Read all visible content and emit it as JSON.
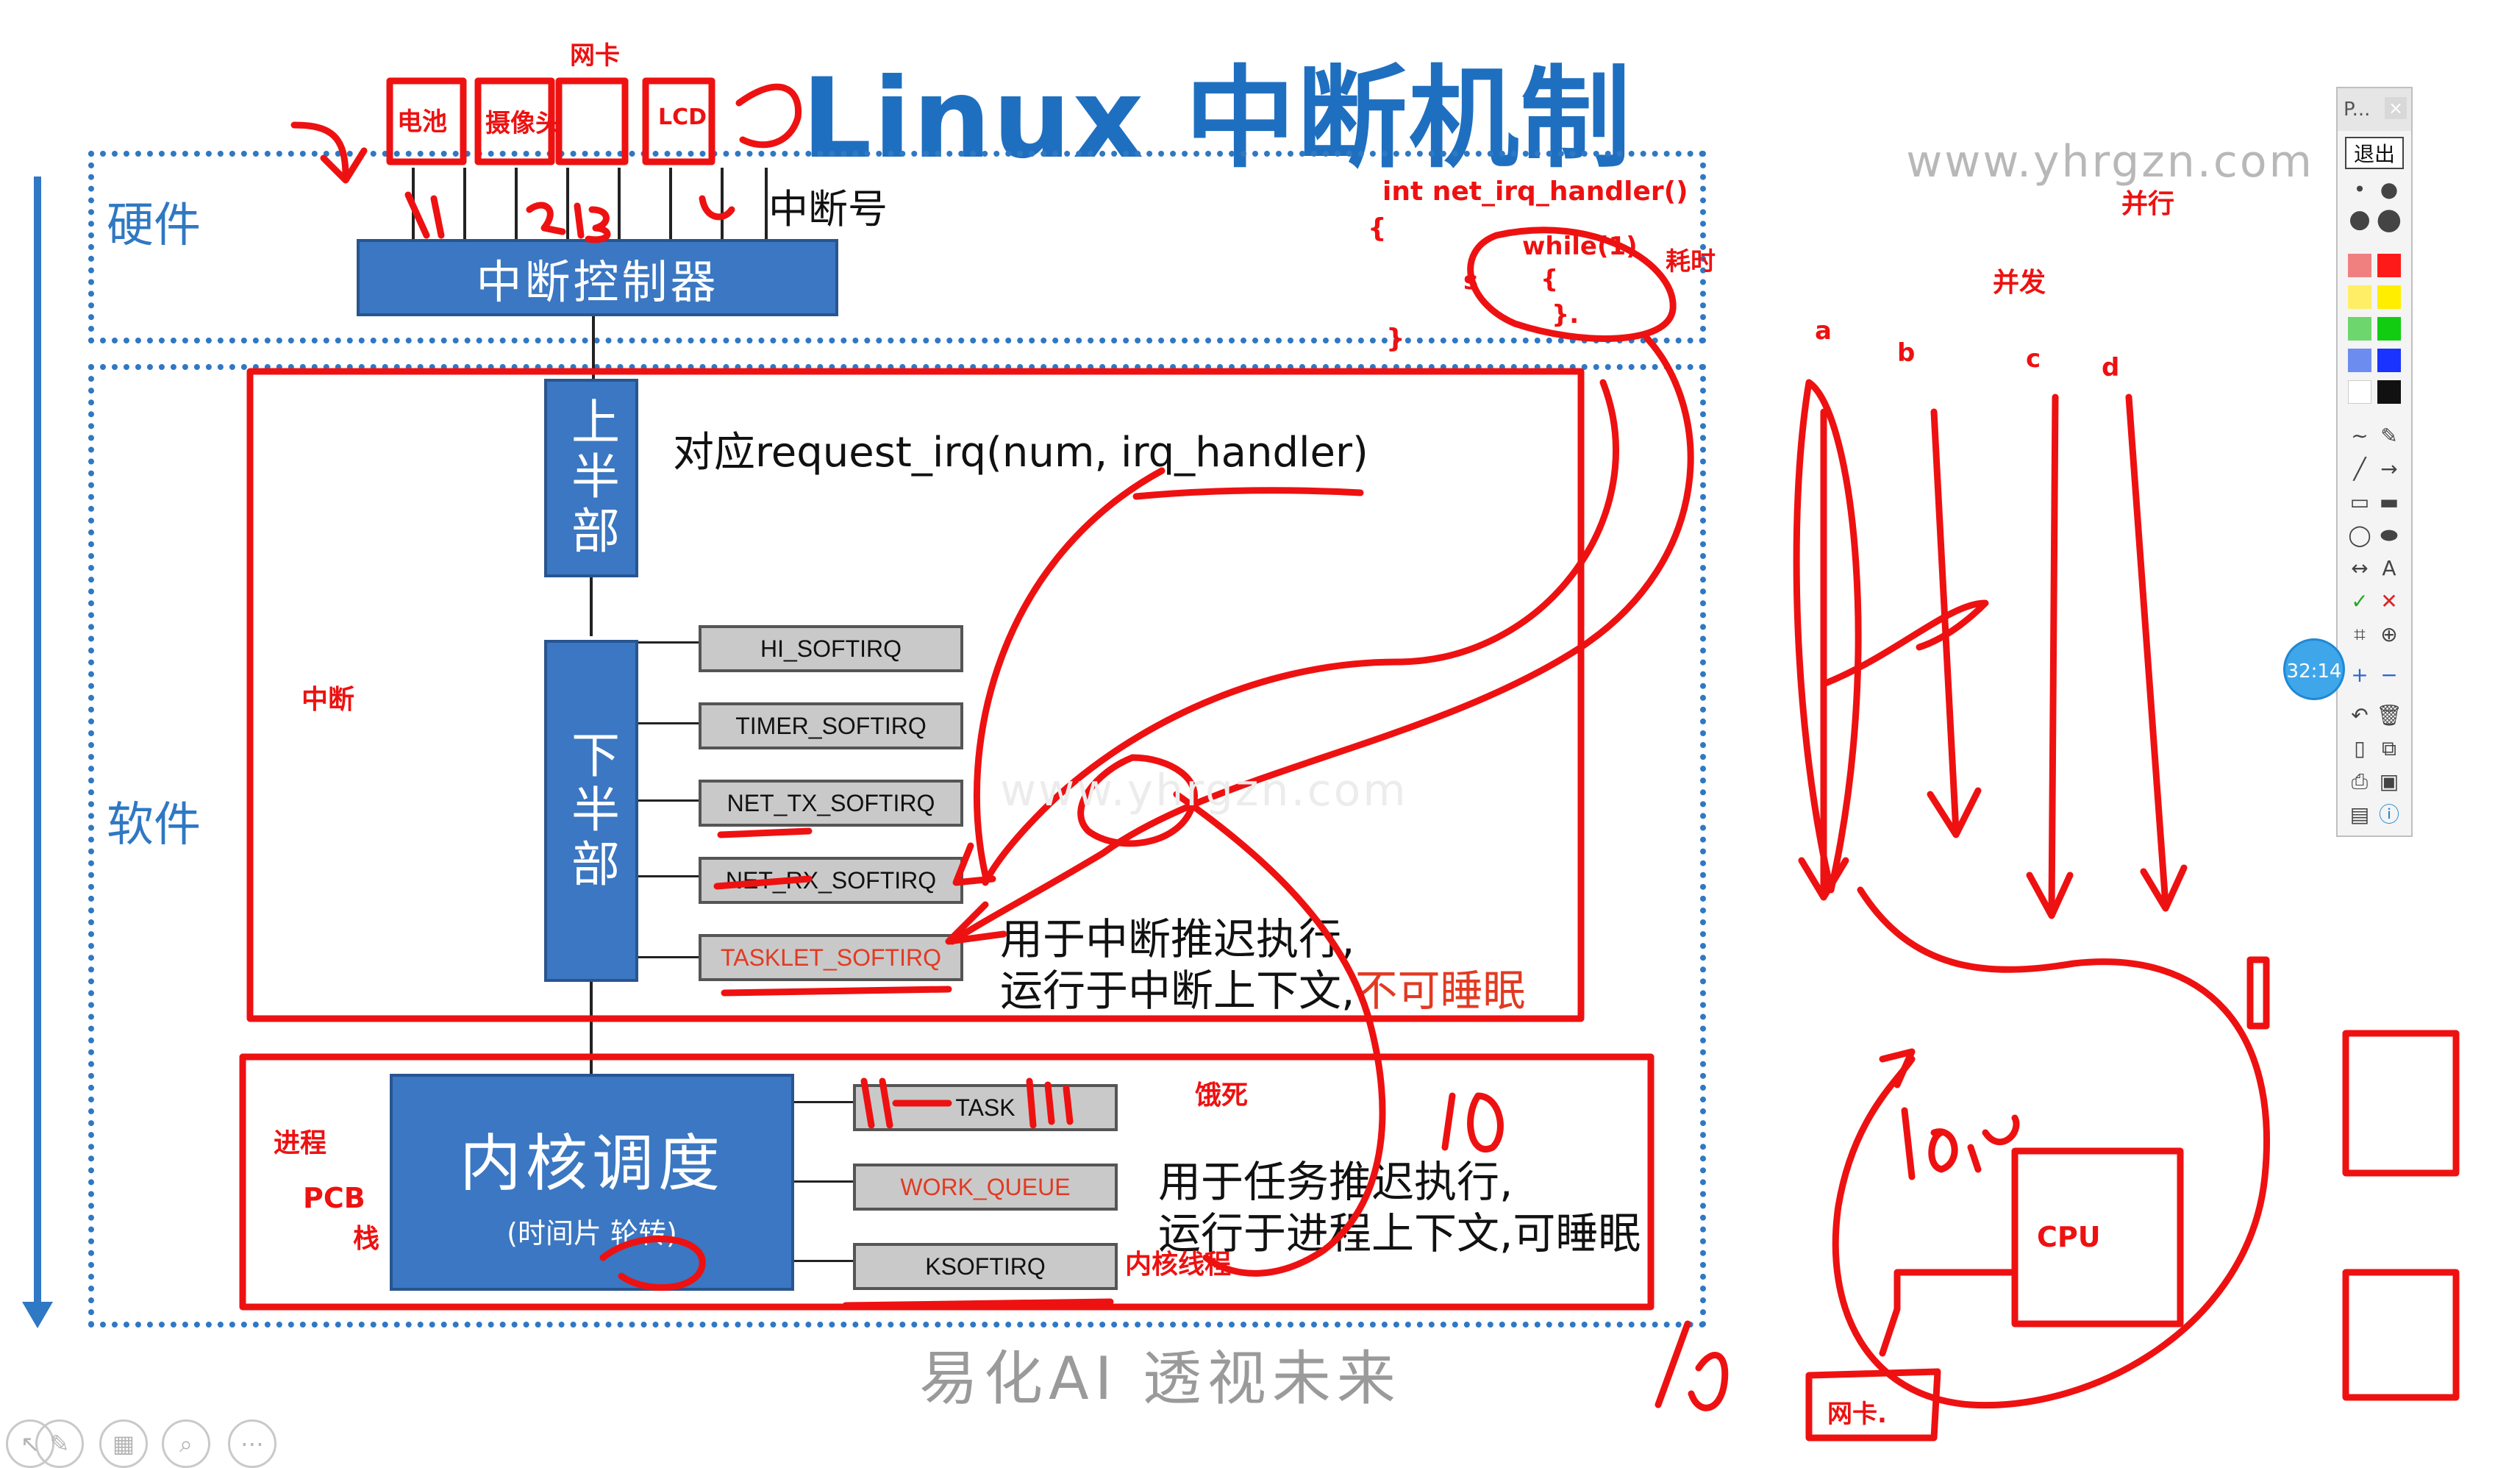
{
  "title": "Linux 中断机制",
  "watermark": "www.yhrgzn.com",
  "footer": "易化AI  透视未来",
  "sections": {
    "hardware": "硬件",
    "software": "软件"
  },
  "hardware": {
    "irq_number_label": "中断号",
    "controller": "中断控制器"
  },
  "software": {
    "top_half": "上半部",
    "bottom_half": "下半部",
    "request_irq_text": "对应request_irq(num, irq_handler)",
    "softirqs": [
      "HI_SOFTIRQ",
      "TIMER_SOFTIRQ",
      "NET_TX_SOFTIRQ",
      "NET_RX_SOFTIRQ",
      "TASKLET_SOFTIRQ"
    ],
    "softirq_note_line1": "用于中断推迟执行,",
    "softirq_note_line2": "运行于中断上下文,",
    "softirq_note_red": "不可睡眠",
    "kernel_sched": "内核调度",
    "kernel_sched_sub": "(时间片 轮转)",
    "tasks": [
      "TASK",
      "WORK_QUEUE",
      "KSOFTIRQ"
    ],
    "task_note_line1": "用于任务推迟执行,",
    "task_note_line2": "运行于进程上下文,可睡眠"
  },
  "annotations": {
    "wangka_top": "网卡",
    "battery": "电池",
    "camera": "摄像头",
    "lcd": "LCD",
    "code_line1": "int  net_irq_handler()",
    "code_brace_open": "{",
    "code_while": "while(1)",
    "code_inner": "{",
    "code_inner_close": "}.",
    "code_brace_close": "}",
    "code_s": "s",
    "haoshi": "耗时",
    "bingxing": "并行",
    "bingfa": "并发",
    "a": "a",
    "b": "b",
    "c": "c",
    "d": "d",
    "zhongduan": "中断",
    "jincheng": "进程",
    "pcb": "PCB",
    "zhan": "栈",
    "esi": "饿死",
    "neihe_xiancheng": "内核线程",
    "ten_a": "10",
    "ten_b": "10",
    "ten_ms": "10ms",
    "cpu": "CPU",
    "wangka_bottom": "网卡."
  },
  "toolbar": {
    "title": "P...",
    "close": "×",
    "exit": "退出",
    "timer": "32:14",
    "text_tool": "A"
  },
  "colors": {
    "title_blue": "#1f6fc0",
    "box_blue": "#3b77c2",
    "annotation_red": "#ee1111",
    "softirq_gray": "#c9c9c9"
  }
}
